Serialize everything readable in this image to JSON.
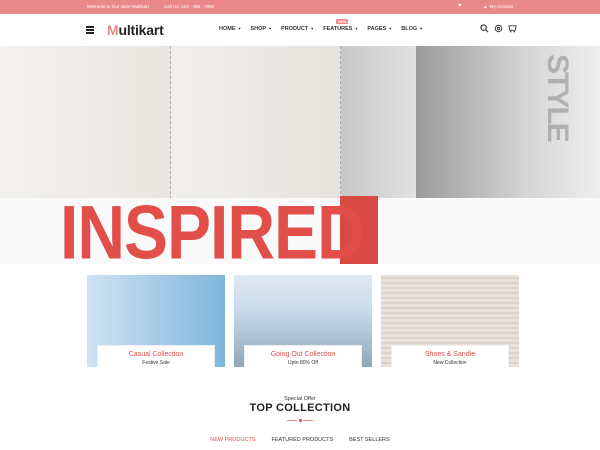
{
  "topbar": {
    "welcome": "Welcome to Our store Multikart",
    "call": "Call Us: 123 - 456 - 7890",
    "account": "My Account"
  },
  "header": {
    "logo_rest": "ultikart",
    "nav": [
      {
        "label": "HOME"
      },
      {
        "label": "SHOP"
      },
      {
        "label": "PRODUCT"
      },
      {
        "label": "FEATURES",
        "badge": "NEW"
      },
      {
        "label": "PAGES"
      },
      {
        "label": "BLOG"
      }
    ]
  },
  "hero": {
    "headline": "INSPIRED",
    "side_text": "STYLE"
  },
  "collections": [
    {
      "title": "Casual Collection",
      "subtitle": "Festive Sale"
    },
    {
      "title": "Going Out Collection",
      "subtitle": "Upto 80% Off"
    },
    {
      "title": "Shoes & Sandle",
      "subtitle": "New Collection"
    }
  ],
  "top_collection": {
    "special": "Special Offer",
    "title": "TOP COLLECTION",
    "tabs": [
      "NEW PRODUCTS",
      "FEATURED PRODUCTS",
      "BEST SELLERS"
    ],
    "active_tab": "NEW PRODUCTS"
  },
  "colors": {
    "accent": "#e9888a",
    "brand_red": "#e24f4b"
  },
  "icons": [
    "heart-icon",
    "user-icon",
    "search-icon",
    "gear-icon",
    "cart-icon",
    "menu-icon"
  ]
}
